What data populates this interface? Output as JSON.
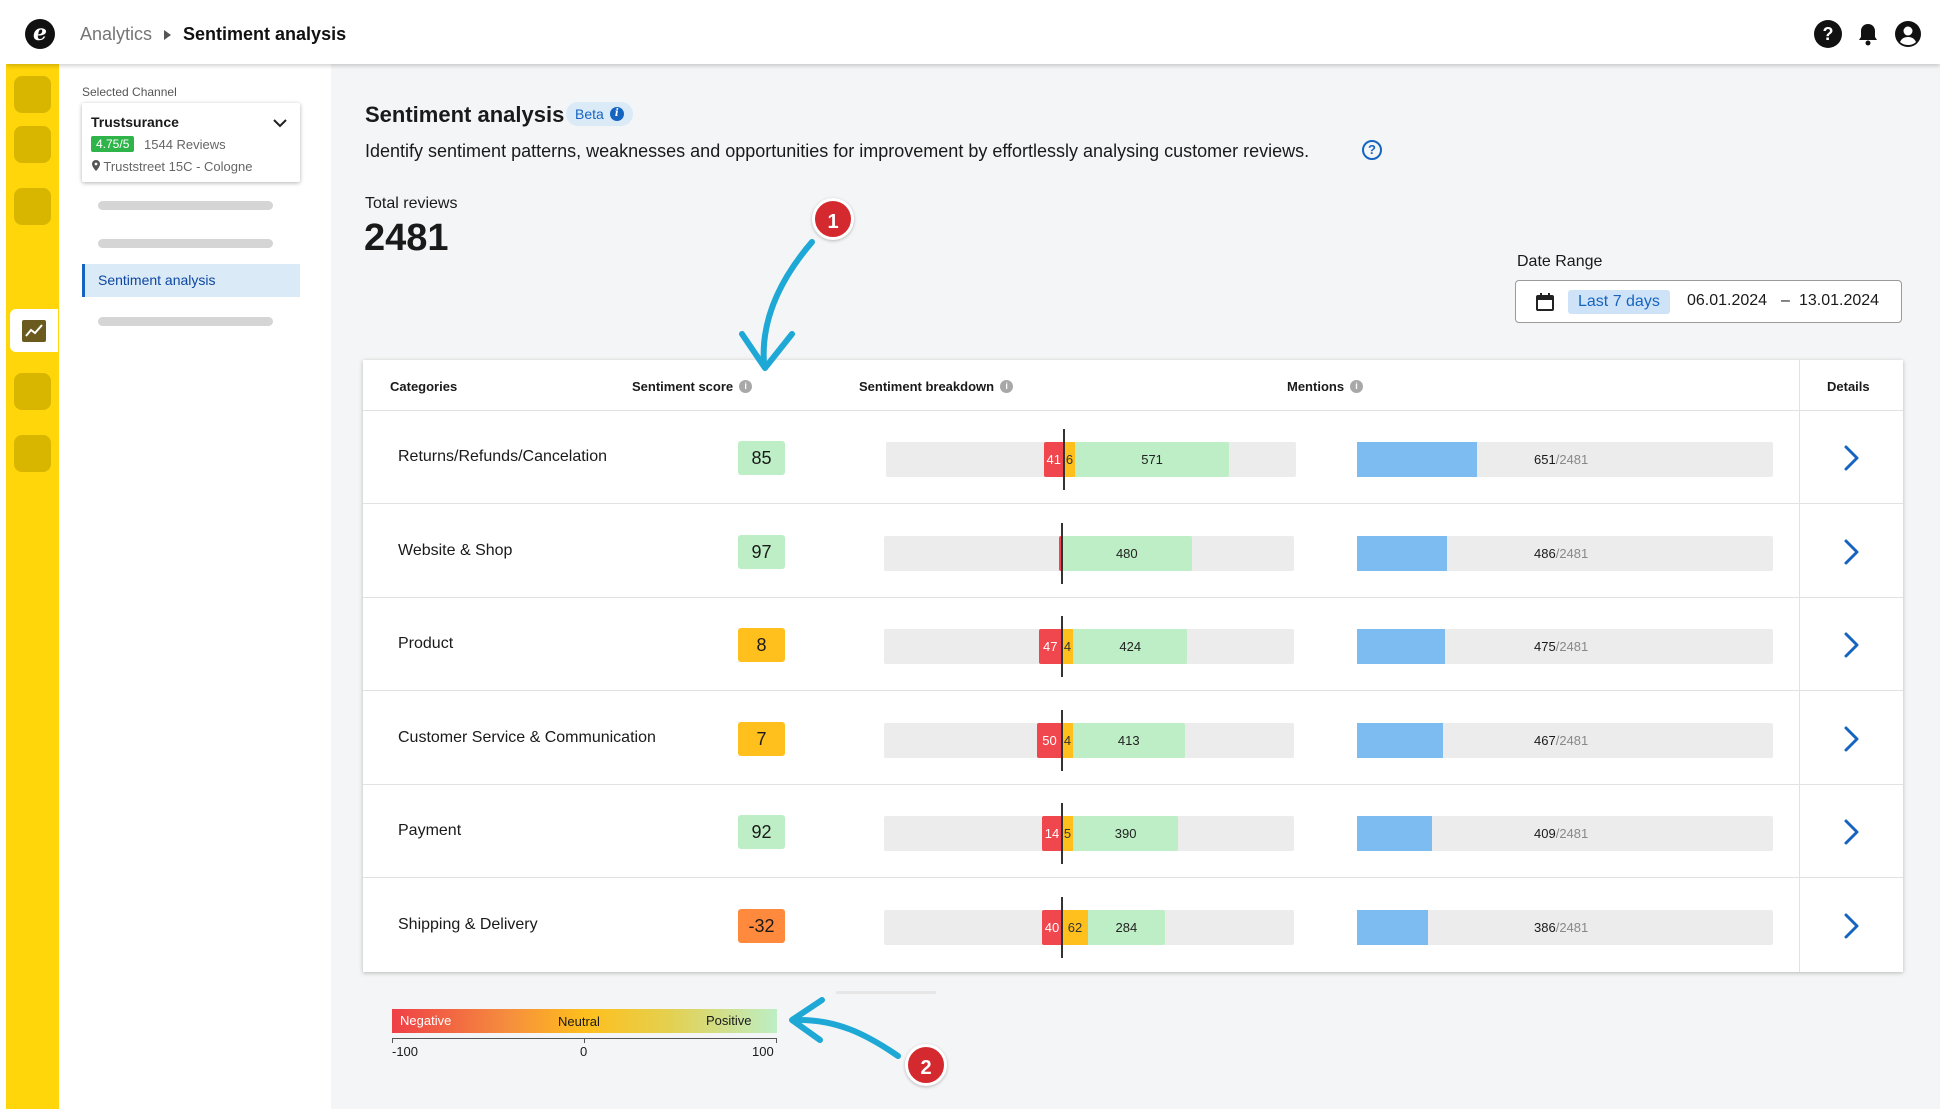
{
  "header": {
    "logo_letter": "e",
    "breadcrumb": [
      "Analytics",
      "Sentiment analysis"
    ],
    "icons": [
      "help-icon",
      "bell-icon",
      "user-icon"
    ],
    "help_glyph": "?"
  },
  "rail": {
    "icons": [
      "nav-placeholder",
      "nav-placeholder",
      "nav-placeholder",
      "analytics-chart-icon",
      "nav-placeholder",
      "nav-placeholder"
    ]
  },
  "sidebar": {
    "channel_label": "Selected Channel",
    "channel": {
      "name": "Trustsurance",
      "rating": "4.75/5",
      "reviews": "1544 Reviews",
      "address": "Truststreet 15C - Cologne"
    },
    "active_item": "Sentiment analysis"
  },
  "main": {
    "title": "Sentiment analysis",
    "badge": "Beta",
    "badge_info": "i",
    "subtitle": "Identify sentiment patterns, weaknesses and opportunities for improvement by effortlessly analysing customer reviews.",
    "help_glyph": "?",
    "total_label": "Total reviews",
    "total_value": "2481",
    "date_range": {
      "label": "Date Range",
      "preset": "Last 7 days",
      "from": "06.01.2024",
      "separator": "–",
      "to": "13.01.2024"
    }
  },
  "table": {
    "headers": {
      "category": "Categories",
      "score": "Sentiment score",
      "breakdown": "Sentiment breakdown",
      "mentions": "Mentions",
      "details": "Details"
    },
    "info_glyph": "i",
    "rows": [
      {
        "category": "Returns/Refunds/Cancelation",
        "score": "85",
        "score_color": "#bdeec5",
        "negative": "41",
        "neutral": "6",
        "positive": "571",
        "mentions": "651",
        "mentions_total": "/2481",
        "mentions_fraction": 0.2624
      },
      {
        "category": "Website & Shop",
        "score": "97",
        "score_color": "#bdeec5",
        "negative": "",
        "neutral": "",
        "positive": "480",
        "mentions": "486",
        "mentions_total": "/2481",
        "mentions_fraction": 0.1959
      },
      {
        "category": "Product",
        "score": "8",
        "score_color": "#ffbf1c",
        "negative": "47",
        "neutral": "4",
        "positive": "424",
        "mentions": "475",
        "mentions_total": "/2481",
        "mentions_fraction": 0.1915
      },
      {
        "category": "Customer Service & Communication",
        "score": "7",
        "score_color": "#ffbf1c",
        "negative": "50",
        "neutral": "4",
        "positive": "413",
        "mentions": "467",
        "mentions_total": "/2481",
        "mentions_fraction": 0.1882
      },
      {
        "category": "Payment",
        "score": "92",
        "score_color": "#bdeec5",
        "negative": "14",
        "neutral": "5",
        "positive": "390",
        "mentions": "409",
        "mentions_total": "/2481",
        "mentions_fraction": 0.1649
      },
      {
        "category": "Shipping & Delivery",
        "score": "-32",
        "score_color": "#ff8a3d",
        "negative": "40",
        "neutral": "62",
        "positive": "284",
        "mentions": "386",
        "mentions_total": "/2481",
        "mentions_fraction": 0.1556
      }
    ]
  },
  "legend": {
    "negative": "Negative",
    "neutral": "Neutral",
    "positive": "Positive",
    "min": "-100",
    "mid": "0",
    "max": "100"
  },
  "annotations": [
    "1",
    "2"
  ],
  "colors": {
    "rail": "#ffd60a",
    "negative": "#f0474f",
    "neutral": "#ffbf1c",
    "positive": "#bdeec5",
    "mentions": "#7dbcf0",
    "accent": "#1565c0",
    "annotation": "#d42a2f",
    "arrow": "#1ea8d6"
  }
}
